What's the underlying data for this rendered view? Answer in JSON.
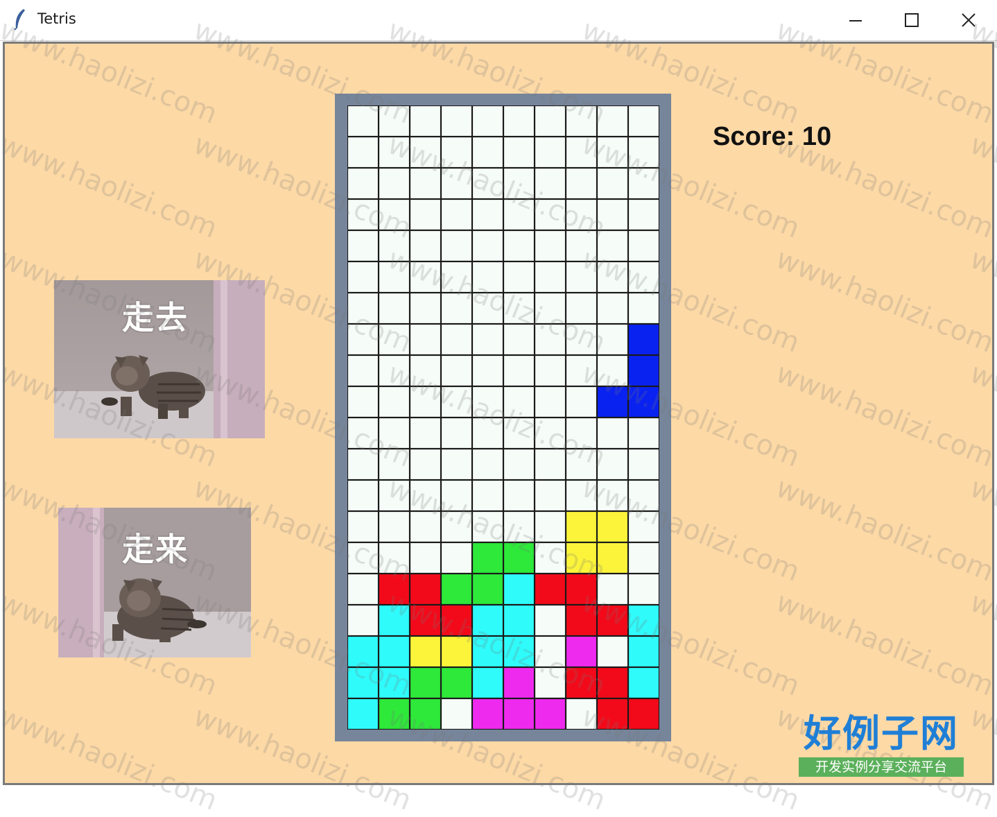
{
  "window": {
    "title": "Tetris",
    "icon": "feather-icon"
  },
  "controls": {
    "minimize": "minimize-icon",
    "maximize": "maximize-icon",
    "close": "close-icon"
  },
  "memes": [
    {
      "caption": "走去"
    },
    {
      "caption": "走来"
    }
  ],
  "score": {
    "text": "Score: 10"
  },
  "board": {
    "cols": 10,
    "rows": 20,
    "colors": {
      "B": "#0a22f0",
      "Y": "#fbf43a",
      "G": "#2ee83a",
      "R": "#f20a1a",
      "C": "#2ffbfb",
      "M": "#ef2aef",
      "empty": "#f6fdf9"
    },
    "cells": [
      "..........",
      "..........",
      "..........",
      "..........",
      "..........",
      "..........",
      "..........",
      ".........B",
      ".........B",
      "........BB",
      "..........",
      "..........",
      "..........",
      ".......YY.",
      "....GG.YY.",
      ".RRGGCRR..",
      ".CRRCC.RRC",
      "CCYYCC.M.C",
      "CCGGCM.RRC",
      "CGG.MMM.RR"
    ]
  },
  "watermark": "www.haolizi.com",
  "brand": {
    "name": "好例子网",
    "tagline": "开发实例分享交流平台"
  }
}
